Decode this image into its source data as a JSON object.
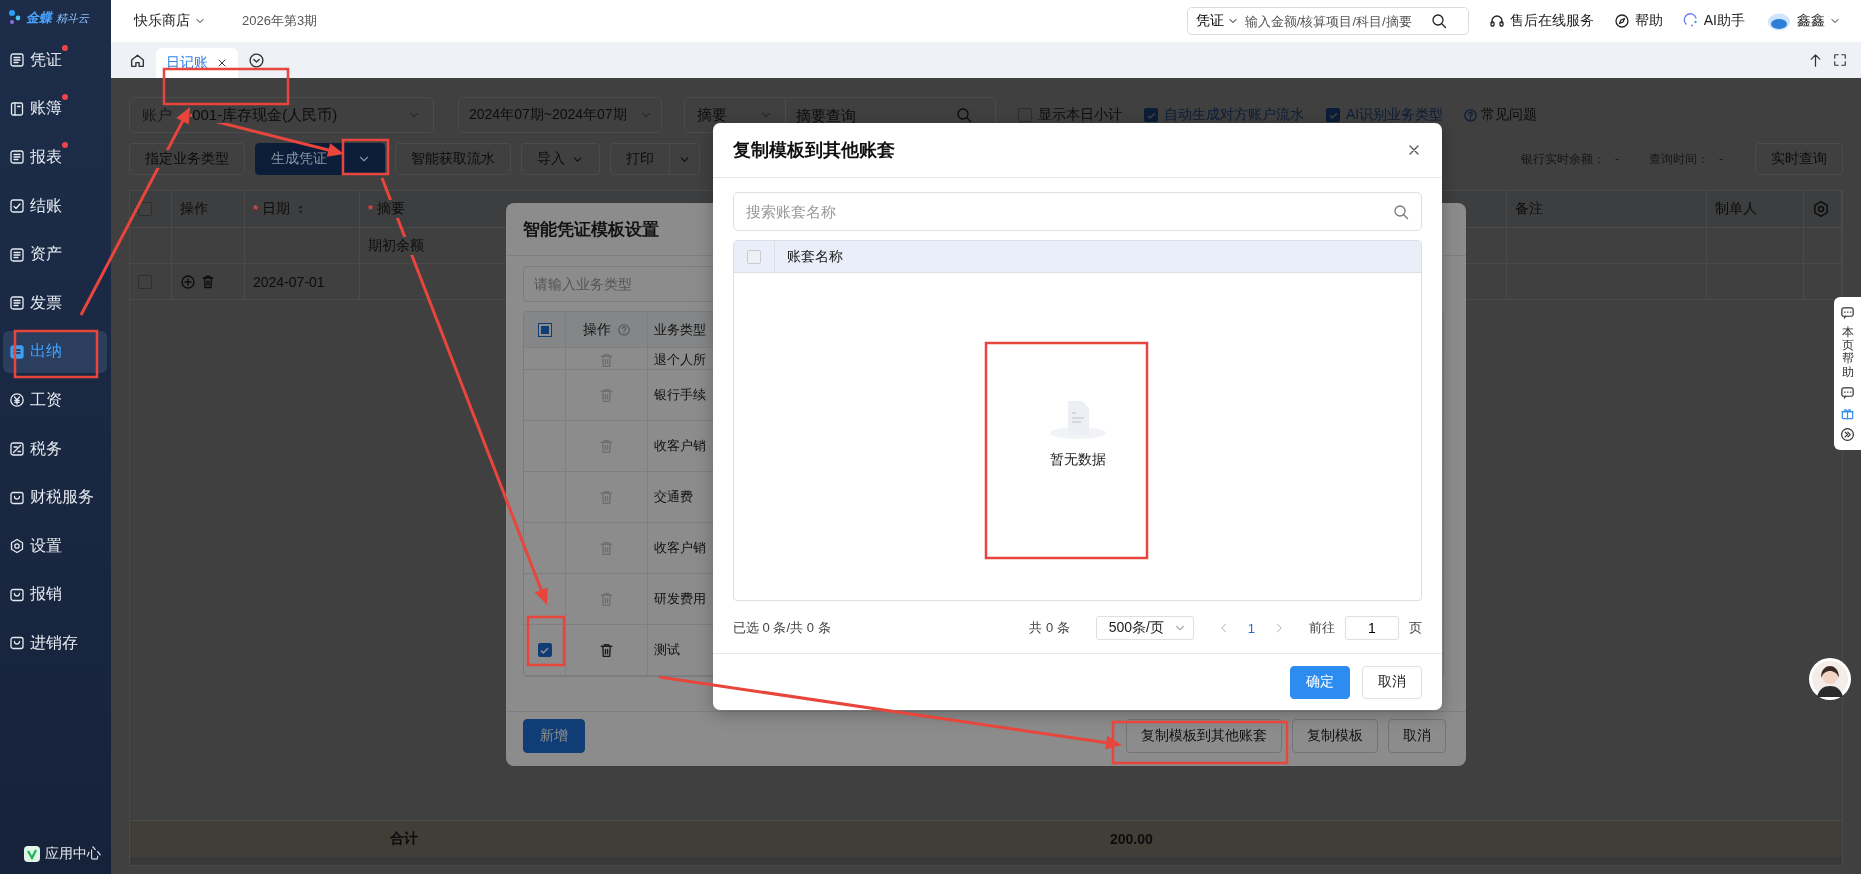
{
  "app": {
    "logo_primary": "金蝶",
    "logo_secondary": "精斗云"
  },
  "sidebar": {
    "items": [
      {
        "label": "凭证",
        "dot": true,
        "selected": false
      },
      {
        "label": "账簿",
        "dot": true,
        "selected": false
      },
      {
        "label": "报表",
        "dot": true,
        "selected": false
      },
      {
        "label": "结账",
        "dot": false,
        "selected": false
      },
      {
        "label": "资产",
        "dot": false,
        "selected": false
      },
      {
        "label": "发票",
        "dot": false,
        "selected": false
      },
      {
        "label": "出纳",
        "dot": false,
        "selected": true
      },
      {
        "label": "工资",
        "dot": false,
        "selected": false
      },
      {
        "label": "税务",
        "dot": false,
        "selected": false
      },
      {
        "label": "财税服务",
        "dot": false,
        "selected": false
      },
      {
        "label": "设置",
        "dot": false,
        "selected": false
      },
      {
        "label": "报销",
        "dot": false,
        "selected": false
      },
      {
        "label": "进销存",
        "dot": false,
        "selected": false
      }
    ],
    "footer": "应用中心"
  },
  "topbar": {
    "company": "快乐商店",
    "period": "2026年第3期",
    "search": {
      "scope": "凭证",
      "placeholder": "输入金额/核算项目/科目/摘要"
    },
    "links": [
      {
        "label": "售后在线服务",
        "kind": "headset"
      },
      {
        "label": "帮助",
        "kind": "compass"
      },
      {
        "label": "AI助手",
        "kind": "ai"
      }
    ],
    "user": "鑫鑫"
  },
  "tabs": [
    {
      "label": "日记账",
      "selected": true
    }
  ],
  "ledger": {
    "filters": {
      "account_label": "账户",
      "account": "001-库存现金(人民币)",
      "period": "2024年07期~2024年07期",
      "summary_scope": "摘要",
      "summary_placeholder": "摘要查询"
    },
    "options": [
      {
        "label": "显示本日小计",
        "checked": false
      },
      {
        "label": "自动生成对方账户流水",
        "checked": true
      },
      {
        "label": "AI识别业务类型",
        "checked": true
      }
    ],
    "faq": "常见问题",
    "toolbar": [
      {
        "label": "指定业务类型",
        "kind": "plain"
      },
      {
        "label": "生成凭证",
        "kind": "split-primary"
      },
      {
        "label": "智能获取流水",
        "kind": "plain"
      },
      {
        "label": "导入",
        "kind": "menu"
      },
      {
        "label": "打印",
        "kind": "split"
      }
    ],
    "bank_balance": {
      "label": "银行实时余额：",
      "value": "-"
    },
    "query_time": {
      "label": "查询时间：",
      "value": "-"
    },
    "query_button": "实时查询",
    "table": {
      "header_checked": false,
      "columns": [
        {
          "label": "操作",
          "sortable": false
        },
        {
          "label": "日期",
          "marker": "*",
          "sortable": true
        },
        {
          "label": "摘要",
          "marker": "*",
          "sortable": false
        },
        {
          "label": "备注",
          "sortable": false
        },
        {
          "label": "制单人",
          "sortable": false
        }
      ],
      "rows": [
        {
          "kind": "opening",
          "summary": "期初余额"
        },
        {
          "kind": "entry",
          "date": "2024-07-01",
          "checked": false
        }
      ],
      "total_label": "合计",
      "total_amount": "200.00"
    }
  },
  "template_dialog": {
    "title": "智能凭证模板设置",
    "search_placeholder": "请输入业务类型",
    "header_checkbox": {
      "indeterminate": true
    },
    "columns": [
      {
        "label": "操作",
        "help": true
      },
      {
        "label": "业务类型",
        "help": false
      }
    ],
    "rows": [
      {
        "type": "退个人所",
        "deletable": false
      },
      {
        "type": "银行手续",
        "deletable": false
      },
      {
        "type": "收客户销",
        "deletable": false
      },
      {
        "type": "交通费",
        "deletable": false
      },
      {
        "type": "收客户销",
        "deletable": false
      },
      {
        "type": "研发费用",
        "deletable": false
      },
      {
        "type": "测试",
        "deletable": true,
        "checked": true
      }
    ],
    "add_button": "新增",
    "buttons": [
      {
        "label": "复制模板到其他账套"
      },
      {
        "label": "复制模板"
      },
      {
        "label": "取消"
      }
    ]
  },
  "copy_dialog": {
    "title": "复制模板到其他账套",
    "search_placeholder": "搜索账套名称",
    "header_checkbox": {
      "disabled": true
    },
    "column": "账套名称",
    "empty_text": "暂无数据",
    "pagination": {
      "selected_summary": "已选 0 条/共 0 条",
      "total": "共 0 条",
      "page_size": "500条/页",
      "current_page": "1",
      "goto_label": "前往",
      "goto_value": "1",
      "page_unit": "页"
    },
    "buttons": [
      {
        "label": "确定",
        "kind": "primary"
      },
      {
        "label": "取消",
        "kind": "default"
      }
    ]
  },
  "help_panel": {
    "label": "本页帮助"
  }
}
